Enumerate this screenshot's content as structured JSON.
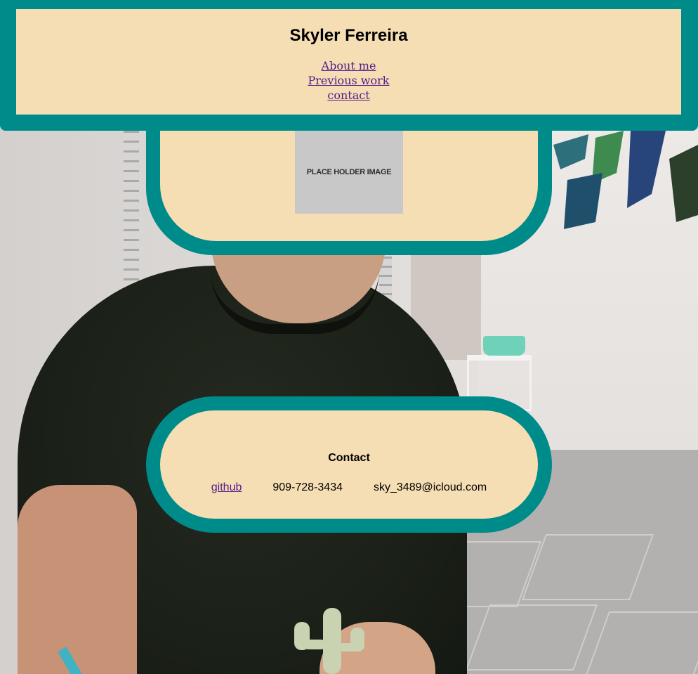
{
  "header": {
    "title": "Skyler Ferreira",
    "nav": [
      {
        "label": "About me"
      },
      {
        "label": "Previous work"
      },
      {
        "label": "contact"
      }
    ]
  },
  "hero": {
    "placeholder_text": "PLACE HOLDER IMAGE"
  },
  "contact": {
    "title": "Contact",
    "github_label": "github",
    "phone": "909-728-3434",
    "email": "sky_3489@icloud.com"
  },
  "colors": {
    "frame": "#008b8b",
    "panel": "#f5deb3",
    "link": "#551a8b"
  }
}
